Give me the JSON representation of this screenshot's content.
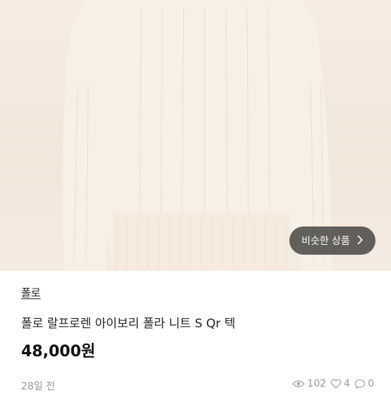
{
  "hero": {
    "similar_button_label": "비슷한 상품",
    "similar_button_icon": "chevron-right-icon"
  },
  "product": {
    "brand": "폴로",
    "title": "폴로 랄프로렌 아이보리 폴라 니트 S Qr 텍",
    "price": "48,000원",
    "posted": "28일 전",
    "views": "102",
    "likes": "4",
    "chats": "0"
  },
  "colors": {
    "sweater": "#f7ede3",
    "overlay_button": "#282828",
    "muted_text": "#999999"
  }
}
